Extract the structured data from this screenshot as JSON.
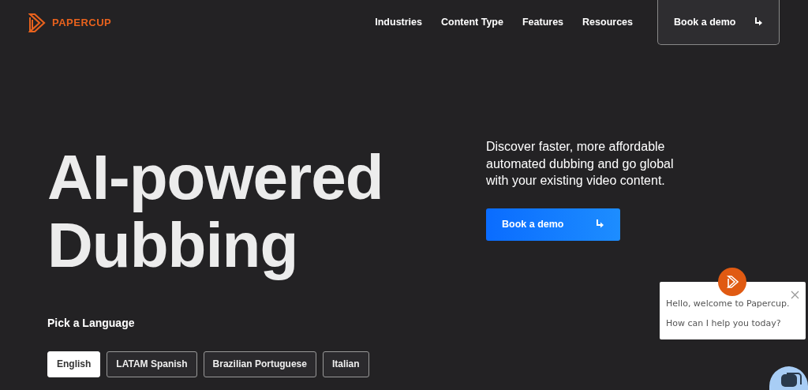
{
  "brand": {
    "name": "PAPERCUP"
  },
  "nav": {
    "links": [
      "Industries",
      "Content Type",
      "Features",
      "Resources"
    ],
    "cta": "Book a demo"
  },
  "hero": {
    "title_lines": [
      "AI-powered",
      "Dubbing"
    ],
    "description": "Discover faster, more affordable automated dubbing and go global with your existing video content.",
    "cta": "Book a demo"
  },
  "languages": {
    "label": "Pick a Language",
    "options": [
      {
        "label": "English",
        "selected": true
      },
      {
        "label": "LATAM Spanish",
        "selected": false
      },
      {
        "label": "Brazilian Portuguese",
        "selected": false
      },
      {
        "label": "Italian",
        "selected": false
      }
    ]
  },
  "chat": {
    "lines": [
      "Hello, welcome to Papercup.",
      "How can I help you today?"
    ]
  }
}
